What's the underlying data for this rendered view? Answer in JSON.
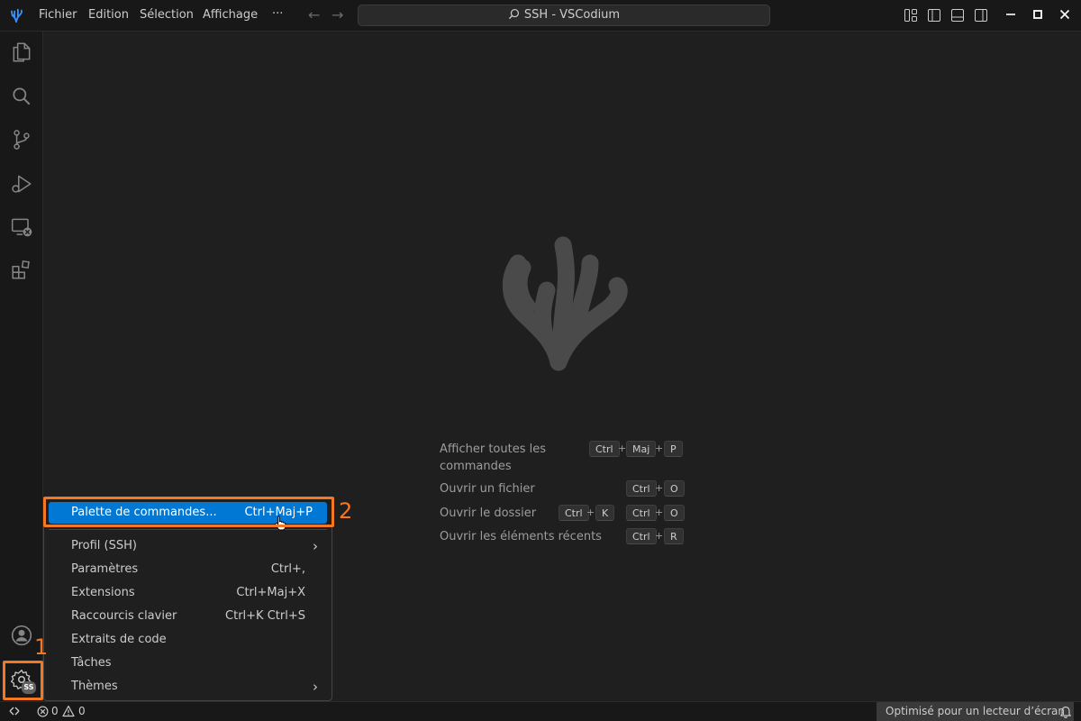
{
  "titlebar": {
    "menus": [
      "Fichier",
      "Edition",
      "Sélection",
      "Affichage",
      "···"
    ],
    "window_title": "SSH - VSCodium"
  },
  "activitybar": {
    "account_badge": "SS"
  },
  "welcome": {
    "shortcuts": [
      {
        "label": "Afficher toutes les commandes",
        "keys": [
          [
            "Ctrl",
            "Maj",
            "P"
          ]
        ]
      },
      {
        "label": "Ouvrir un fichier",
        "keys": [
          [
            "Ctrl",
            "O"
          ]
        ]
      },
      {
        "label": "Ouvrir le dossier",
        "keys": [
          [
            "Ctrl",
            "K"
          ],
          [
            "Ctrl",
            "O"
          ]
        ]
      },
      {
        "label": "Ouvrir les éléments récents",
        "keys": [
          [
            "Ctrl",
            "R"
          ]
        ]
      }
    ]
  },
  "context_menu": {
    "items": [
      {
        "label": "Palette de commandes...",
        "shortcut": "Ctrl+Maj+P",
        "highlighted": true
      },
      {
        "label": "Profil (SSH)",
        "shortcut": "",
        "submenu": true
      },
      {
        "label": "Paramètres",
        "shortcut": "Ctrl+,"
      },
      {
        "label": "Extensions",
        "shortcut": "Ctrl+Maj+X"
      },
      {
        "label": "Raccourcis clavier",
        "shortcut": "Ctrl+K Ctrl+S"
      },
      {
        "label": "Extraits de code",
        "shortcut": ""
      },
      {
        "label": "Tâches",
        "shortcut": ""
      },
      {
        "label": "Thèmes",
        "shortcut": "",
        "submenu": true
      }
    ]
  },
  "statusbar": {
    "errors": "0",
    "warnings": "0",
    "screen_reader": "Optimisé pour un lecteur d’écran"
  },
  "annotations": {
    "step1": "1",
    "step2": "2"
  },
  "colors": {
    "accent": "#0078d4",
    "annotation": "#f47721",
    "background": "#1f1f1f"
  }
}
